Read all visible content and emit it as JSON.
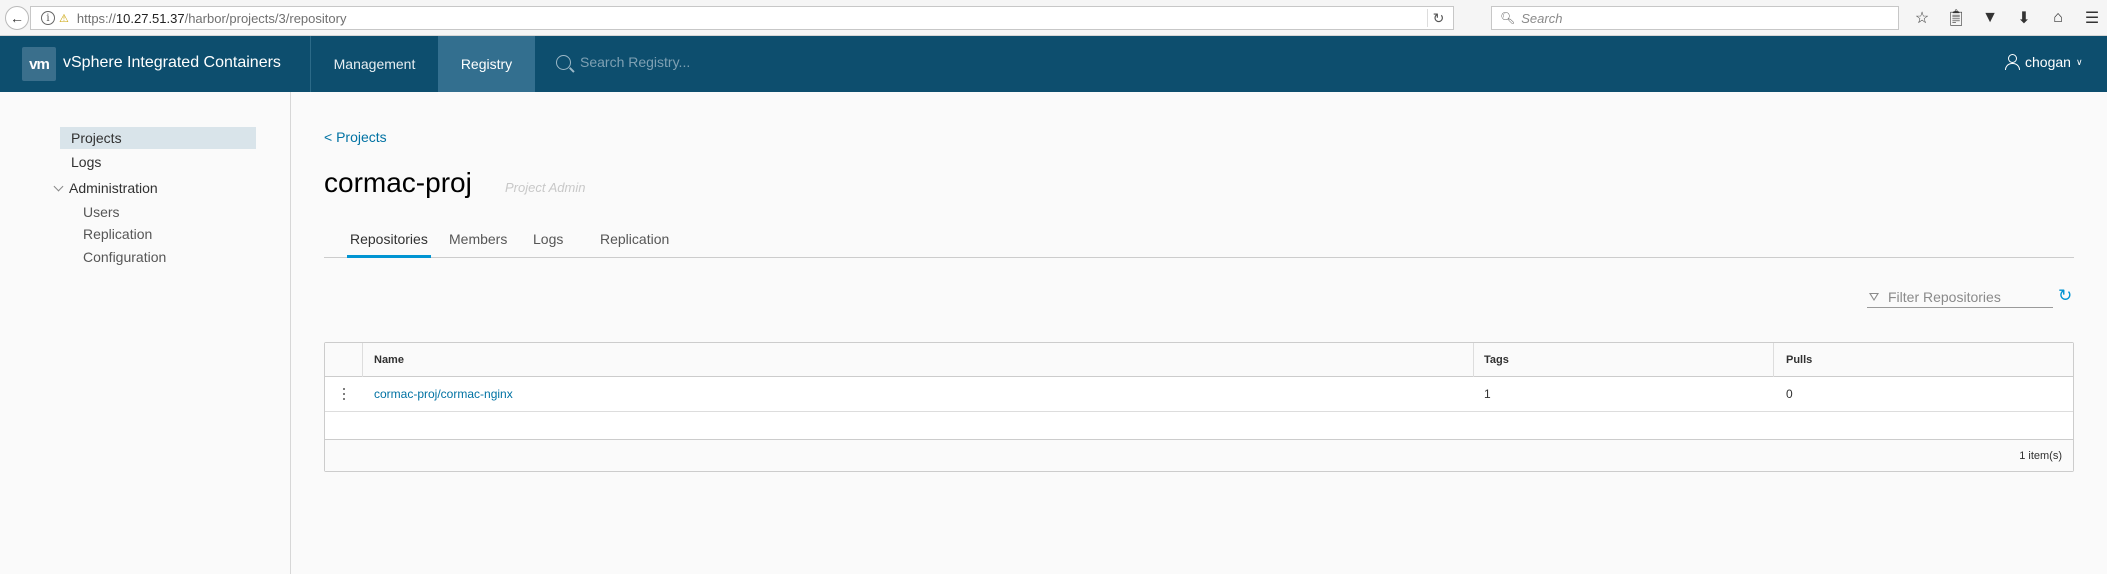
{
  "browser": {
    "back_icon": "back-arrow-icon",
    "url_prefix": "https://",
    "url_host": "10.27.51.37",
    "url_path": "/harbor/projects/3/repository",
    "search_placeholder": "Search",
    "toolbar_icons": [
      "star-icon",
      "clipboard-icon",
      "pocket-icon",
      "download-icon",
      "home-icon",
      "menu-icon"
    ]
  },
  "header": {
    "logo": "vm",
    "app_title": "vSphere Integrated Containers",
    "nav": {
      "management": "Management",
      "registry": "Registry"
    },
    "search_placeholder": "Search Registry...",
    "user": "chogan",
    "colors": {
      "header_bg": "#0d4e6e",
      "active_nav_bg": "#336f8f"
    }
  },
  "sidebar": {
    "projects": "Projects",
    "logs": "Logs",
    "administration": "Administration",
    "admin_items": {
      "users": "Users",
      "replication": "Replication",
      "configuration": "Configuration"
    }
  },
  "main": {
    "breadcrumb": "< Projects",
    "title": "cormac-proj",
    "role": "Project Admin",
    "tabs": {
      "repositories": "Repositories",
      "members": "Members",
      "logs": "Logs",
      "replication": "Replication"
    },
    "active_tab": "Repositories",
    "filter_placeholder": "Filter Repositories",
    "table": {
      "columns": {
        "name": "Name",
        "tags": "Tags",
        "pulls": "Pulls"
      },
      "rows": [
        {
          "name": "cormac-proj/cormac-nginx",
          "tags": "1",
          "pulls": "0"
        }
      ],
      "footer": "1 item(s)"
    },
    "accent_color": "#0094d2",
    "link_color": "#0072a3"
  }
}
